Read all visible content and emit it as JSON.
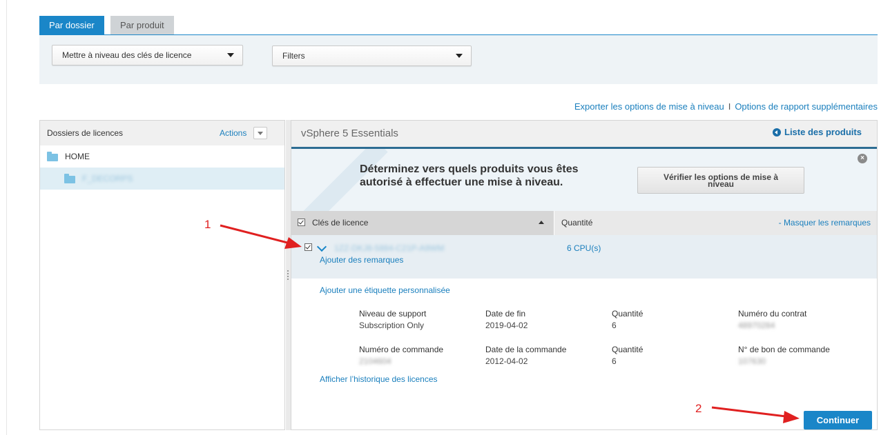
{
  "tabs": [
    {
      "label": "Par dossier",
      "active": true
    },
    {
      "label": "Par produit",
      "active": false
    }
  ],
  "dropdowns": {
    "action": "Mettre à niveau des clés de licence",
    "filters": "Filters"
  },
  "top_links": {
    "export": "Exporter les options de mise à niveau",
    "separator": "I",
    "reports": "Options de rapport supplémentaires"
  },
  "left_panel": {
    "title": "Dossiers de licences",
    "actions_label": "Actions",
    "folders": [
      {
        "name": "HOME",
        "level": 0
      },
      {
        "name": "F_DECORPS",
        "level": 1,
        "selected": true
      }
    ]
  },
  "right_panel": {
    "product_title": "vSphere 5 Essentials",
    "back_link": "Liste des produits",
    "banner_text_line1": "Déterminez vers quels produits vous êtes",
    "banner_text_line2": "autorisé à effectuer une mise à niveau.",
    "verify_button_line1": "Vérifier les options de mise à",
    "verify_button_line2": "niveau",
    "close_icon": "×",
    "table": {
      "col_keys": "Clés de licence",
      "col_quantity": "Quantité",
      "hide_notes": "- Masquer les remarques"
    },
    "license": {
      "key": "1ZZ-DKJ8-5884-C21P-A9WM",
      "quantity": "6 CPU(s)",
      "add_notes": "Ajouter des remarques",
      "add_tag": "Ajouter une étiquette personnalisée",
      "details": [
        [
          {
            "label": "Niveau de support",
            "value": "Subscription Only"
          },
          {
            "label": "Date de fin",
            "value": "2019-04-02"
          },
          {
            "label": "Quantité",
            "value": "6"
          },
          {
            "label": "Numéro du contrat",
            "value": "48970284"
          }
        ],
        [
          {
            "label": "Numéro de commande",
            "value": "2104604"
          },
          {
            "label": "Date de la commande",
            "value": "2012-04-02"
          },
          {
            "label": "Quantité",
            "value": "6"
          },
          {
            "label": "N° de bon de commande",
            "value": "107630"
          }
        ]
      ],
      "history_link": "Afficher l’historique des licences"
    },
    "continue_label": "Continuer"
  },
  "annotations": {
    "one": "1",
    "two": "2"
  },
  "colors": {
    "accent": "#1a86c8",
    "arrow": "#e02020"
  }
}
